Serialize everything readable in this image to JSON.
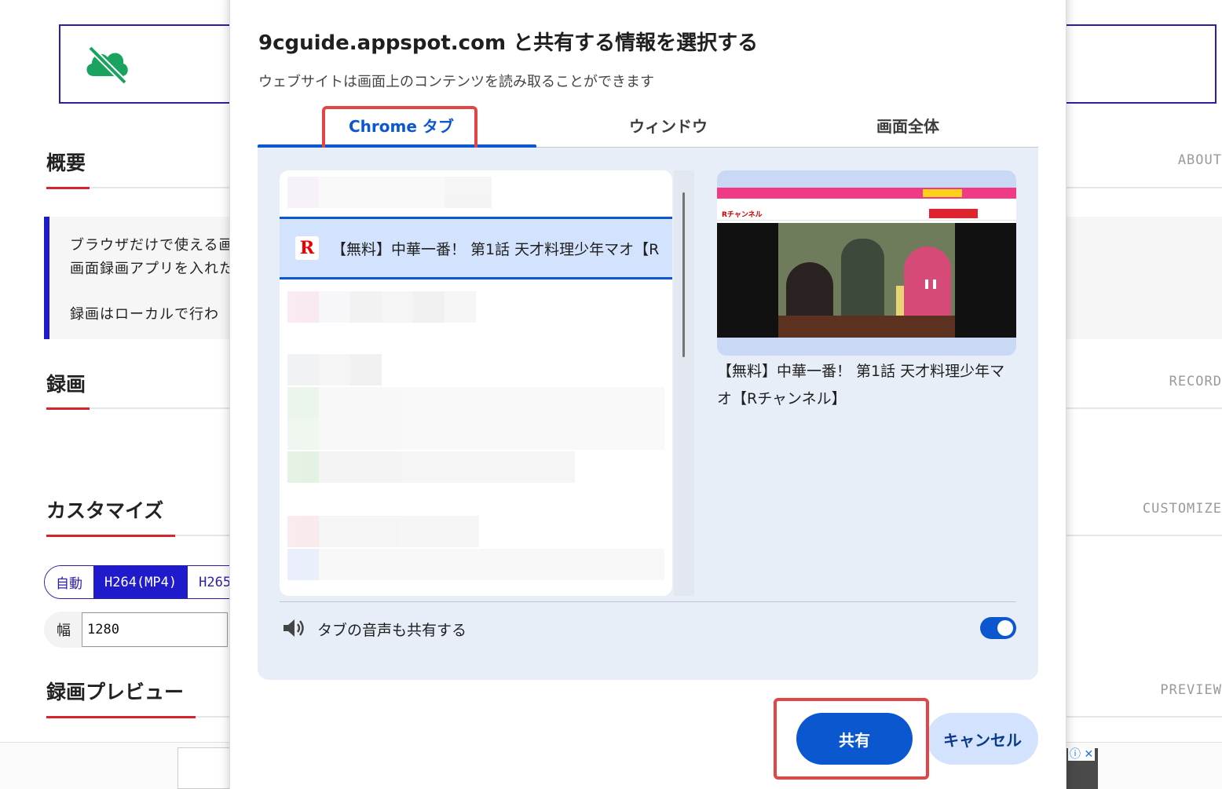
{
  "background": {
    "sections": [
      {
        "title": "概要",
        "side": "ABOUT"
      },
      {
        "title": "録画",
        "side": "RECORD"
      },
      {
        "title": "カスタマイズ",
        "side": "CUSTOMIZE"
      },
      {
        "title": "録画プレビュー",
        "side": "PREVIEW"
      }
    ],
    "overview_lines": [
      "ブラウザだけで使える画",
      "画面録画アプリを入れた",
      "録画はローカルで行わ"
    ],
    "codec_options": [
      "自動",
      "H264(MP4)",
      "H265"
    ],
    "width_label": "幅",
    "width_value": "1280",
    "ad_info": "ⓘ ✕"
  },
  "dialog": {
    "title": "9cguide.appspot.com と共有する情報を選択する",
    "subtitle": "ウェブサイトは画面上のコンテンツを読み取ることができます",
    "tabs": [
      {
        "label": "Chrome タブ",
        "active": true
      },
      {
        "label": "ウィンドウ",
        "active": false
      },
      {
        "label": "画面全体",
        "active": false
      }
    ],
    "selected_tab_item": {
      "favicon": "R",
      "label": "【無料】中華一番！ 第1話 天才料理少年マオ【R"
    },
    "preview_caption": "【無料】中華一番！ 第1話 天才料理少年マオ【Rチャンネル】",
    "preview_logo": "Rチャンネル",
    "audio_label": "タブの音声も共有する",
    "audio_enabled": true,
    "share_label": "共有",
    "cancel_label": "キャンセル"
  },
  "colors": {
    "accent": "#0b57d0",
    "highlight": "#e24545",
    "section_red": "#d9232d",
    "brand_blue": "#1f1acb"
  }
}
